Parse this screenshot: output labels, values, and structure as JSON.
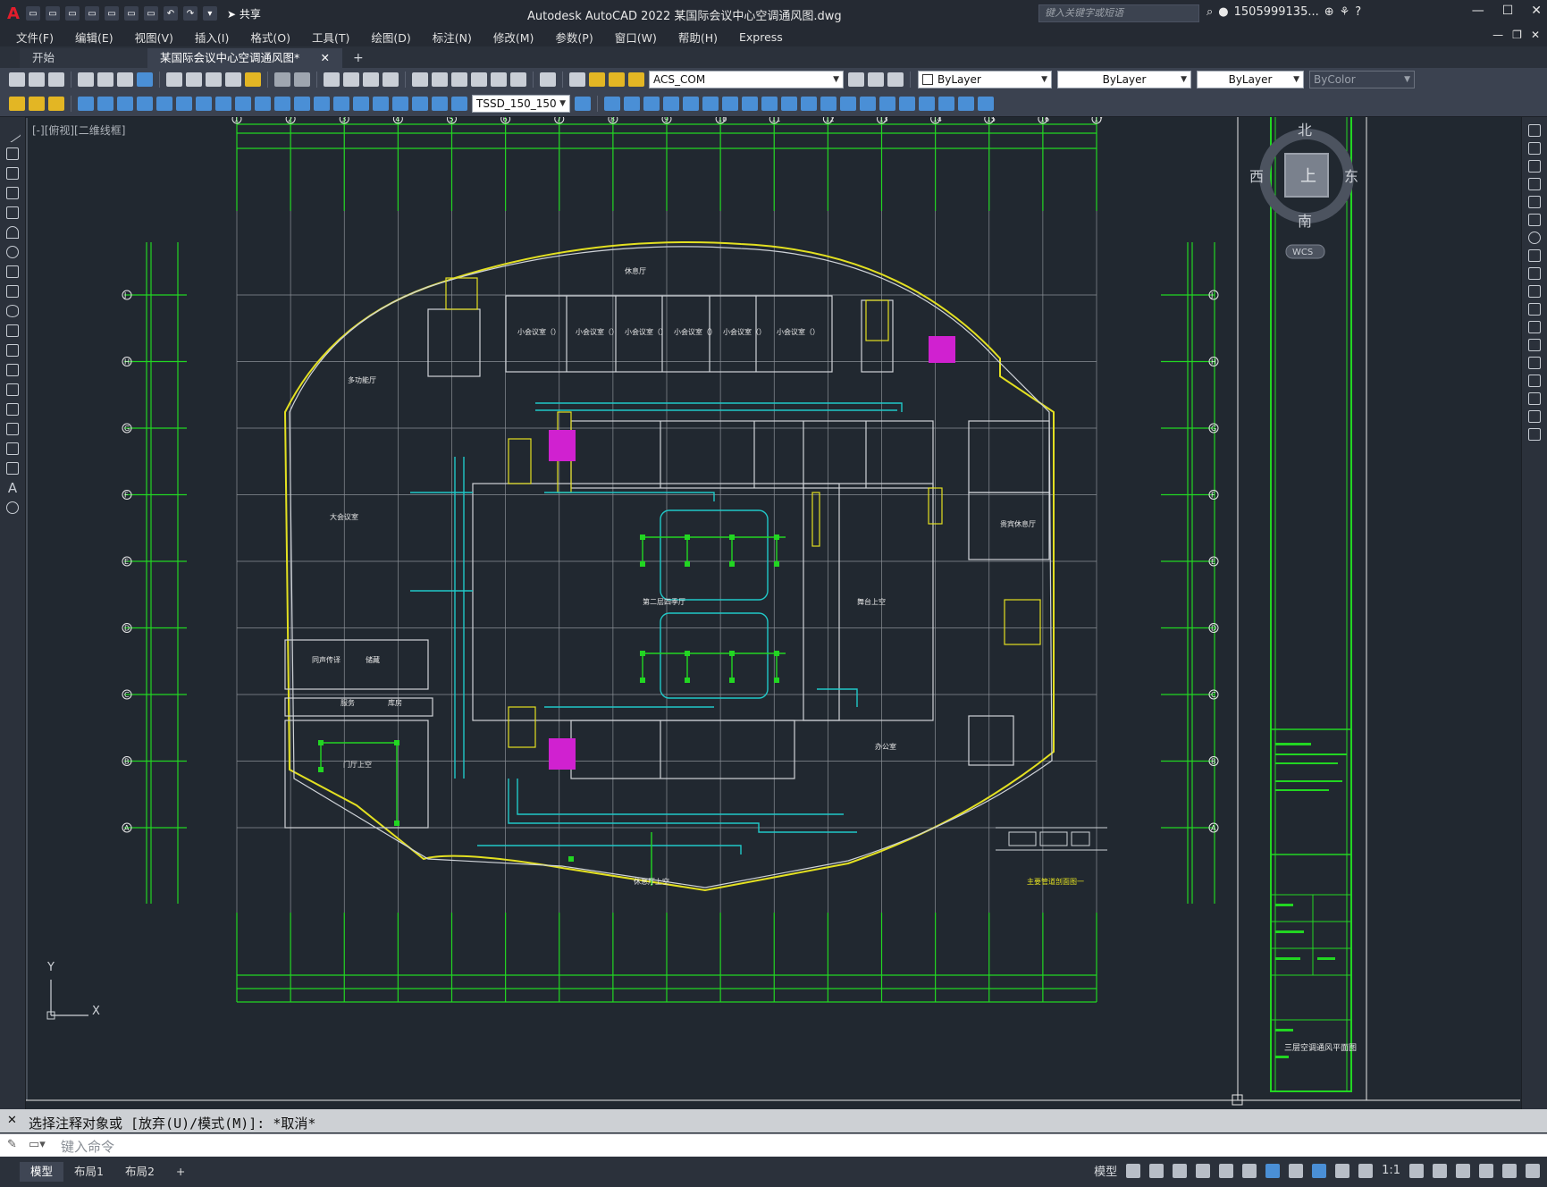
{
  "app": {
    "title": "Autodesk AutoCAD 2022    某国际会议中心空调通风图.dwg",
    "share_label": "共享",
    "search_placeholder": "键入关键字或短语",
    "user": "1505999135...",
    "logo": "A"
  },
  "menu": [
    "文件(F)",
    "编辑(E)",
    "视图(V)",
    "插入(I)",
    "格式(O)",
    "工具(T)",
    "绘图(D)",
    "标注(N)",
    "修改(M)",
    "参数(P)",
    "窗口(W)",
    "帮助(H)",
    "Express"
  ],
  "tabs": {
    "start": "开始",
    "drawing": "某国际会议中心空调通风图*",
    "close": "✕",
    "add": "+"
  },
  "toolbar": {
    "layer": "ACS_COM",
    "color": "ByLayer",
    "linetype": "ByLayer",
    "lineweight": "ByLayer",
    "plotstyle": "ByColor",
    "dimstyle": "TSSD_150_150"
  },
  "viewport_label": "[-][俯视][二维线框]",
  "viewcube": {
    "north": "北",
    "south": "南",
    "east": "东",
    "west": "西",
    "face": "上",
    "wcs": "WCS"
  },
  "drawing": {
    "axis_top": [
      "1",
      "2",
      "3",
      "4",
      "5",
      "6",
      "7",
      "8",
      "9",
      "10",
      "11",
      "12",
      "13",
      "14",
      "15",
      "16",
      "17"
    ],
    "axis_left": [
      "J",
      "H",
      "G",
      "F",
      "E",
      "D",
      "C",
      "B",
      "A"
    ],
    "rooms": [
      {
        "name": "休息厅"
      },
      {
        "name": "多功能厅"
      },
      {
        "name": "小会议室（）"
      },
      {
        "name": "小会议室（）"
      },
      {
        "name": "小会议室（）"
      },
      {
        "name": "小会议室（）"
      },
      {
        "name": "小会议室（）"
      },
      {
        "name": "小会议室（）"
      },
      {
        "name": "大会议室"
      },
      {
        "name": "第二层四季厅"
      },
      {
        "name": "舞台上空"
      },
      {
        "name": "贵宾休息厅"
      },
      {
        "name": "门厅上空"
      },
      {
        "name": "同声传译"
      },
      {
        "name": "办公室"
      },
      {
        "name": "休息厅上空"
      },
      {
        "name": "服务"
      },
      {
        "name": "库房"
      },
      {
        "name": "储藏"
      }
    ],
    "title_block_text": "三层空调通风平面图",
    "section_label": "主要管道剖面图一"
  },
  "ucs": {
    "x": "X",
    "y": "Y"
  },
  "command": {
    "history": "选择注释对象或 [放弃(U)/模式(M)]: *取消*",
    "placeholder": "键入命令"
  },
  "status": {
    "tabs": [
      "模型",
      "布局1",
      "布局2"
    ],
    "add": "+",
    "model_label": "模型",
    "scale": "1:1"
  }
}
